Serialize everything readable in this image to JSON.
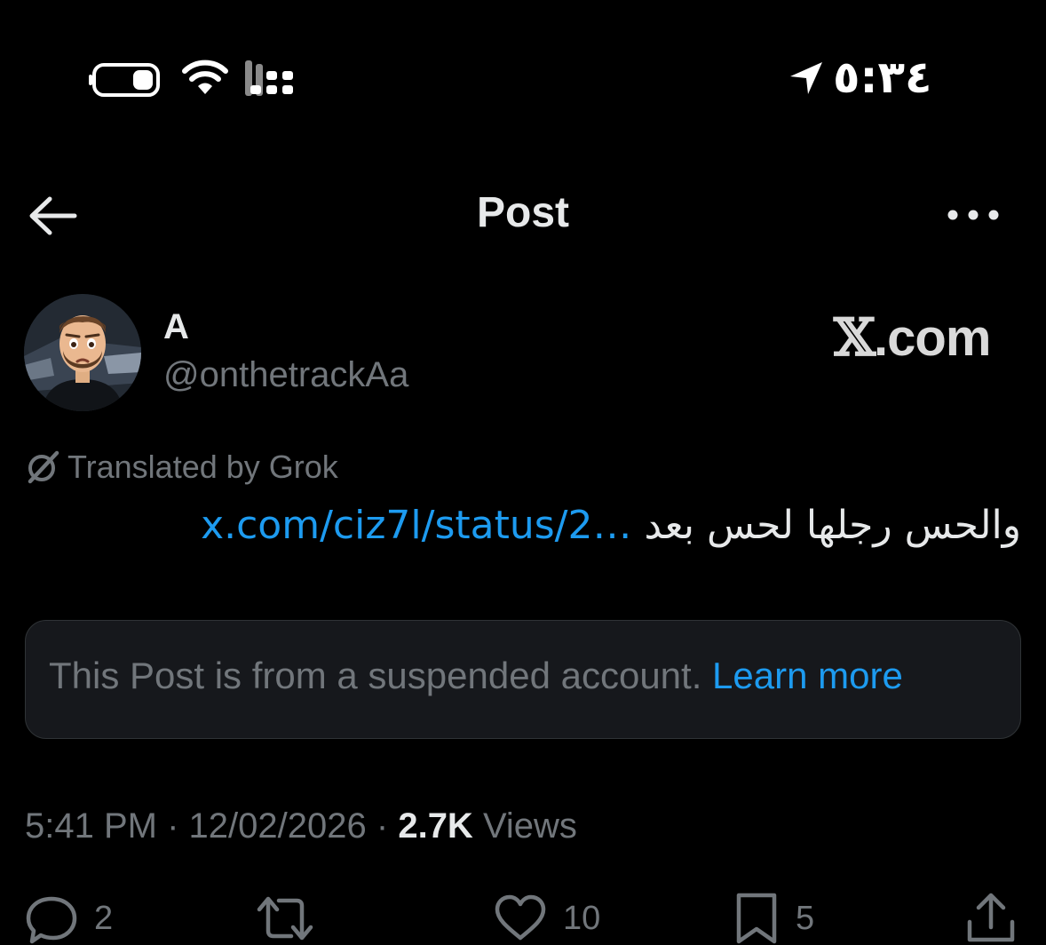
{
  "status_bar": {
    "time": "٥:٣٤",
    "icons": [
      "location-arrow-icon",
      "wifi-icon",
      "cellular-signal-icon",
      "battery-icon"
    ]
  },
  "header": {
    "title": "Post",
    "back_icon": "back-arrow-icon",
    "more_icon": "more-horizontal-icon"
  },
  "author": {
    "name": "A",
    "handle": "@onthetrackAa",
    "avatar": "memoji-avatar"
  },
  "brand": {
    "x_letter": "𝕏",
    "domain": ".com"
  },
  "translation": {
    "label": "Translated by Grok",
    "icon": "grok-icon"
  },
  "post": {
    "text_arabic": "والحس رجلها لحس بعد",
    "link": "x.com/ciz7l/status/2…"
  },
  "suspended_notice": {
    "text": "This Post is from a suspended account.",
    "learn_more": "Learn more"
  },
  "meta": {
    "time": "5:41 PM",
    "separator": "·",
    "date": "12/02/2026",
    "views_count": "2.7K",
    "views_label": "Views"
  },
  "actions": {
    "replies": "2",
    "likes": "10",
    "bookmarks": "5"
  },
  "colors": {
    "background": "#000000",
    "accent_blue": "#1d9bf0",
    "secondary_text": "#71767b",
    "primary_text": "#e7e9ea",
    "card_bg": "#16181c",
    "card_border": "#2f3336"
  }
}
